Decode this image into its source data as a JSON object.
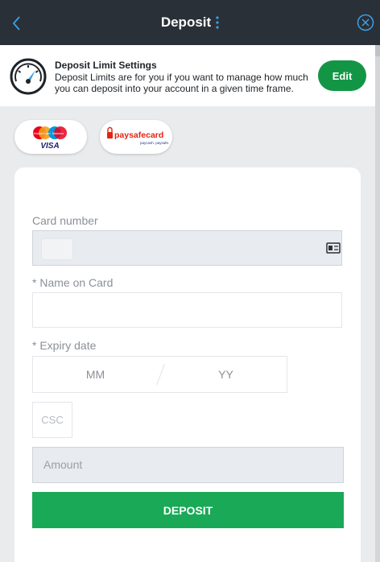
{
  "header": {
    "title": "Deposit"
  },
  "deposit_limit": {
    "title": "Deposit Limit Settings",
    "description": "Deposit Limits are for you if you want to manage how much you can deposit into your account in a given time frame.",
    "edit_label": "Edit"
  },
  "payment_methods": [
    {
      "name": "visa-mastercard-maestro",
      "labels": [
        "MasterCard",
        "Maestro",
        "VISA"
      ]
    },
    {
      "name": "paysafecard",
      "labels": [
        "paysafecard",
        "paycash. paysafe."
      ]
    }
  ],
  "form": {
    "card_number_label": "Card number",
    "name_label": "* Name on Card",
    "expiry_label": "* Expiry date",
    "expiry_month_placeholder": "MM",
    "expiry_year_placeholder": "YY",
    "csc_placeholder": "CSC",
    "amount_placeholder": "Amount",
    "deposit_label": "DEPOSIT"
  },
  "colors": {
    "header_bg": "#2a3037",
    "accent_green": "#129645",
    "deposit_green": "#1aa957",
    "icon_blue": "#3aa0e6"
  }
}
